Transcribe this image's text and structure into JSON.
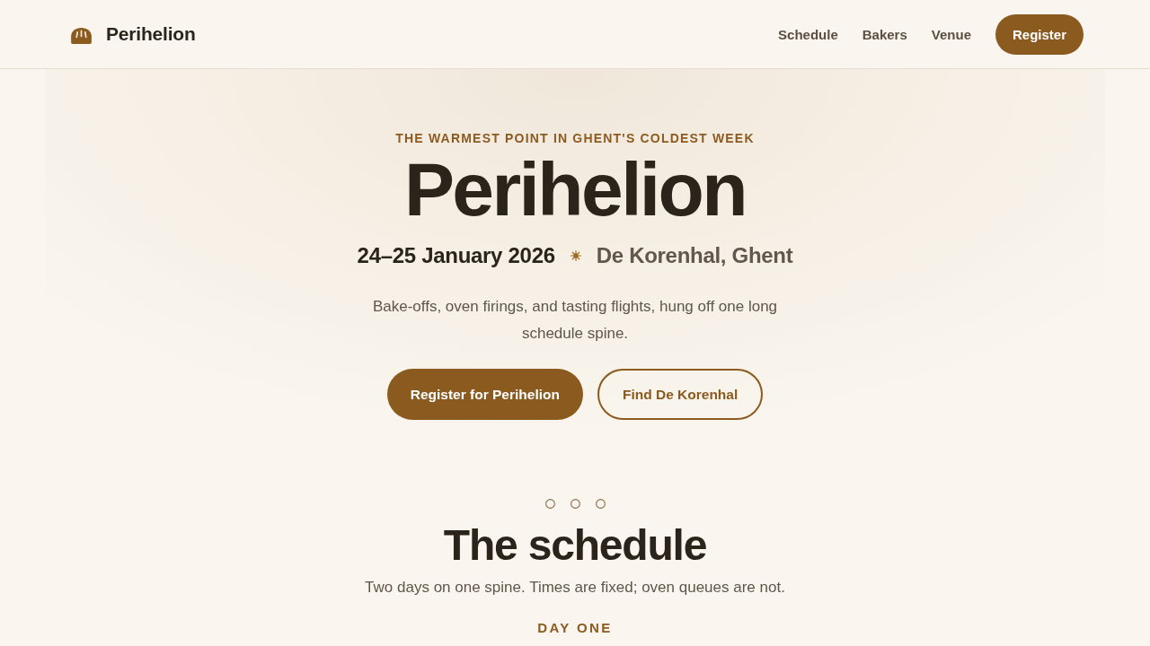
{
  "header": {
    "brand": "Perihelion",
    "nav": [
      "Schedule",
      "Bakers",
      "Venue"
    ],
    "cta": "Register"
  },
  "hero": {
    "eyebrow": "THE WARMEST POINT IN GHENT'S COLDEST WEEK",
    "title": "Perihelion",
    "date": "24–25 January 2026",
    "venue": "De Korenhal, Ghent",
    "description": "Bake-offs, oven firings, and tasting flights, hung off one long schedule spine.",
    "buttons": [
      {
        "label": "Register for Perihelion",
        "kind": "primary"
      },
      {
        "label": "Find De Korenhal",
        "kind": "secondary"
      }
    ]
  },
  "schedule": {
    "title": "The schedule",
    "subtitle": "Two days on one spine. Times are fixed; oven queues are not.",
    "day_label": "DAY ONE"
  }
}
